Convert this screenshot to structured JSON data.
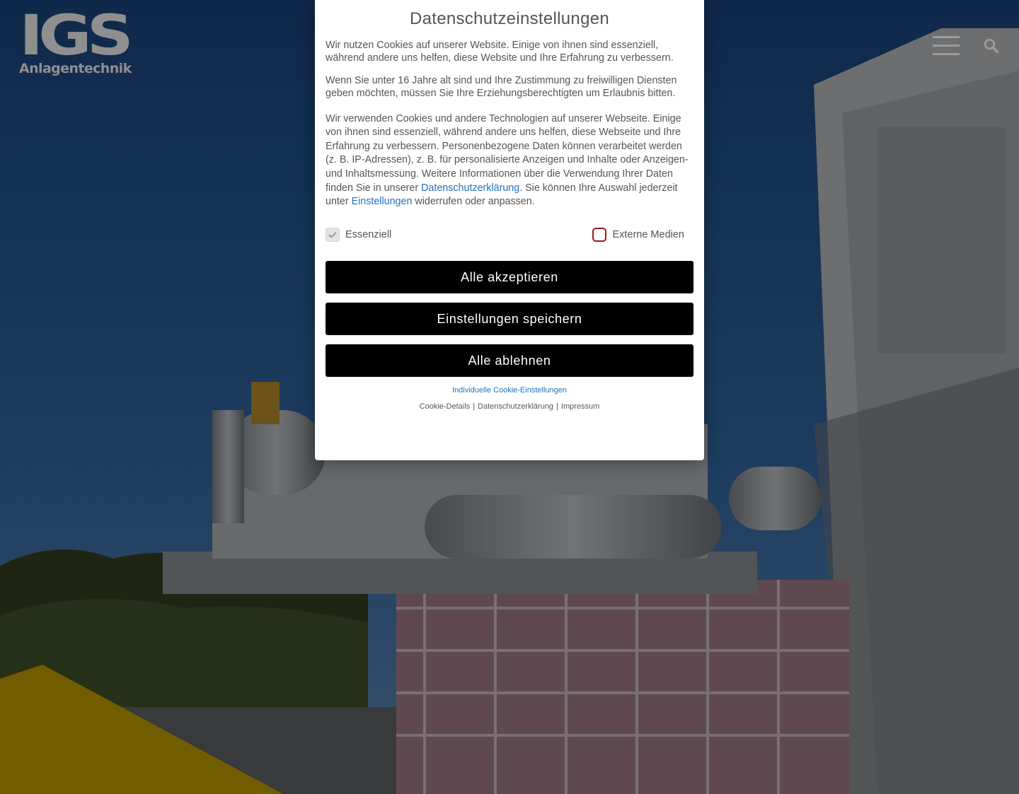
{
  "header": {
    "logo_mark": "IGS",
    "logo_sub": "Anlagentechnik"
  },
  "icons": {
    "menu": "hamburger-icon",
    "search": "search-icon",
    "check": "checkmark-icon"
  },
  "colors": {
    "link": "#1e73be",
    "button_bg": "#000000",
    "checkbox_border": "#a3161f",
    "logo_gray": "#8f8f8f"
  },
  "cookie_banner": {
    "title": "Datenschutzeinstellungen",
    "intro": "Wir nutzen Cookies auf unserer Website. Einige von ihnen sind essenziell, während andere uns helfen, diese Website und Ihre Erfahrung zu verbessern.",
    "minor_notice": "Wenn Sie unter 16 Jahre alt sind und Ihre Zustimmung zu freiwilligen Diensten geben möchten, müssen Sie Ihre Erziehungsberechtigten um Erlaubnis bitten.",
    "details_text_1": "Wir verwenden Cookies und andere Technologien auf unserer Webseite. Einige von ihnen sind essenziell, während andere uns helfen, diese Webseite und Ihre Erfahrung zu verbessern. Personenbezogene Daten können verarbeitet werden (z. B. IP-Adressen), z. B. für personalisierte Anzeigen und Inhalte oder Anzeigen- und Inhaltsmessung. Weitere Informationen über die Verwendung Ihrer Daten finden Sie in unserer ",
    "privacy_link": "Datenschutzerklärung",
    "details_text_2": ". Sie können Ihre Auswahl jederzeit unter ",
    "settings_link": "Einstellungen",
    "details_text_3": " widerrufen oder anpassen.",
    "checkboxes": [
      {
        "label": "Essenziell",
        "checked": true,
        "disabled": true
      },
      {
        "label": "Externe Medien",
        "checked": false,
        "disabled": false
      }
    ],
    "buttons": {
      "accept_all": "Alle akzeptieren",
      "save_settings": "Einstellungen speichern",
      "reject_all": "Alle ablehnen"
    },
    "individual_link": "Individuelle Cookie-Einstellungen",
    "footer_links": {
      "cookie_details": "Cookie-Details",
      "privacy": "Datenschutzerklärung",
      "imprint": "Impressum",
      "separator": "|"
    }
  }
}
